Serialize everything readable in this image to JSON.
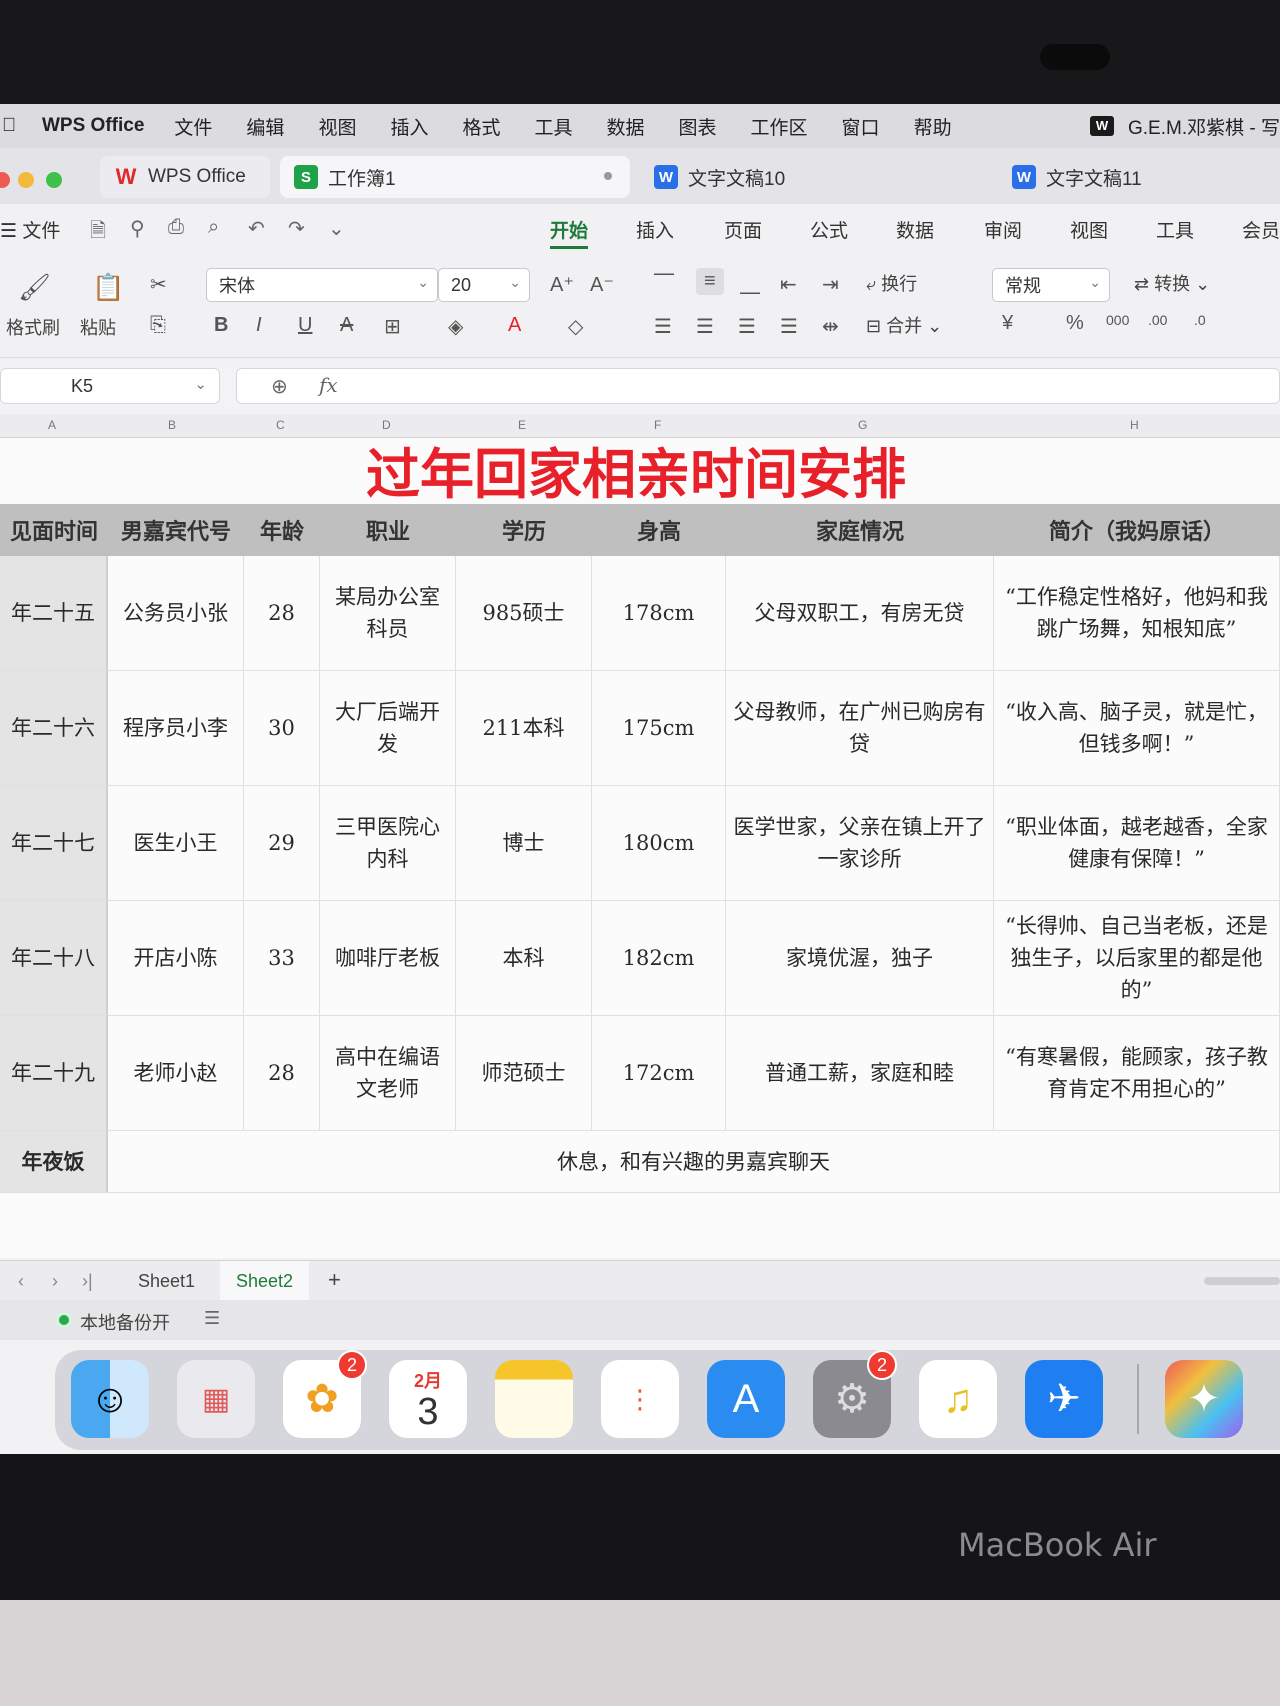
{
  "menubar": {
    "app_name": "WPS Office",
    "items": [
      "文件",
      "编辑",
      "视图",
      "插入",
      "格式",
      "工具",
      "数据",
      "图表",
      "工作区",
      "窗口",
      "帮助"
    ],
    "user": "G.E.M.邓紫棋 - 写"
  },
  "tabs": [
    {
      "label": "WPS Office"
    },
    {
      "label": "工作簿1"
    },
    {
      "label": "文字文稿10"
    },
    {
      "label": "文字文稿11"
    }
  ],
  "ribbon": {
    "file_label": "文件",
    "tabs": [
      "开始",
      "插入",
      "页面",
      "公式",
      "数据",
      "审阅",
      "视图",
      "工具",
      "会员"
    ],
    "format_painter": "格式刷",
    "paste": "粘贴",
    "font_name": "宋体",
    "font_size": "20",
    "wrap": "换行",
    "merge": "合并",
    "number_format": "常规",
    "convert": "转换"
  },
  "formula": {
    "cell_ref": "K5",
    "fx": "fx"
  },
  "columns": [
    "A",
    "B",
    "C",
    "D",
    "E",
    "F",
    "G",
    "H"
  ],
  "sheet": {
    "title": "过年回家相亲时间安排",
    "headers": [
      "见面时间",
      "男嘉宾代号",
      "年龄",
      "职业",
      "学历",
      "身高",
      "家庭情况",
      "简介（我妈原话）"
    ],
    "rows": [
      [
        "年二十五",
        "公务员小张",
        "28",
        "某局办公室科员",
        "985硕士",
        "178cm",
        "父母双职工，有房无贷",
        "“工作稳定性格好，他妈和我跳广场舞，知根知底”"
      ],
      [
        "年二十六",
        "程序员小李",
        "30",
        "大厂后端开发",
        "211本科",
        "175cm",
        "父母教师，在广州已购房有贷",
        "“收入高、脑子灵，就是忙，但钱多啊！”"
      ],
      [
        "年二十七",
        "医生小王",
        "29",
        "三甲医院心内科",
        "博士",
        "180cm",
        "医学世家，父亲在镇上开了一家诊所",
        "“职业体面，越老越香，全家健康有保障！”"
      ],
      [
        "年二十八",
        "开店小陈",
        "33",
        "咖啡厅老板",
        "本科",
        "182cm",
        "家境优渥，独子",
        "“长得帅、自己当老板，还是独生子，以后家里的都是他的”"
      ],
      [
        "年二十九",
        "老师小赵",
        "28",
        "高中在编语文老师",
        "师范硕士",
        "172cm",
        "普通工薪，家庭和睦",
        "“有寒暑假，能顾家，孩子教育肯定不用担心的”"
      ]
    ],
    "last_row": {
      "label": "年夜饭",
      "text": "休息，和有兴趣的男嘉宾聊天"
    }
  },
  "sheet_tabs": [
    "Sheet1",
    "Sheet2"
  ],
  "status": {
    "backup": "本地备份开"
  },
  "dock": {
    "photos_badge": "2",
    "calendar_month": "2月",
    "calendar_day": "3",
    "settings_badge": "2"
  },
  "hardware": {
    "brand": "MacBook Air"
  },
  "colors": {
    "title": "#e8202a",
    "accent_green": "#1f7a3a",
    "header_bg": "#bfbfbf"
  }
}
